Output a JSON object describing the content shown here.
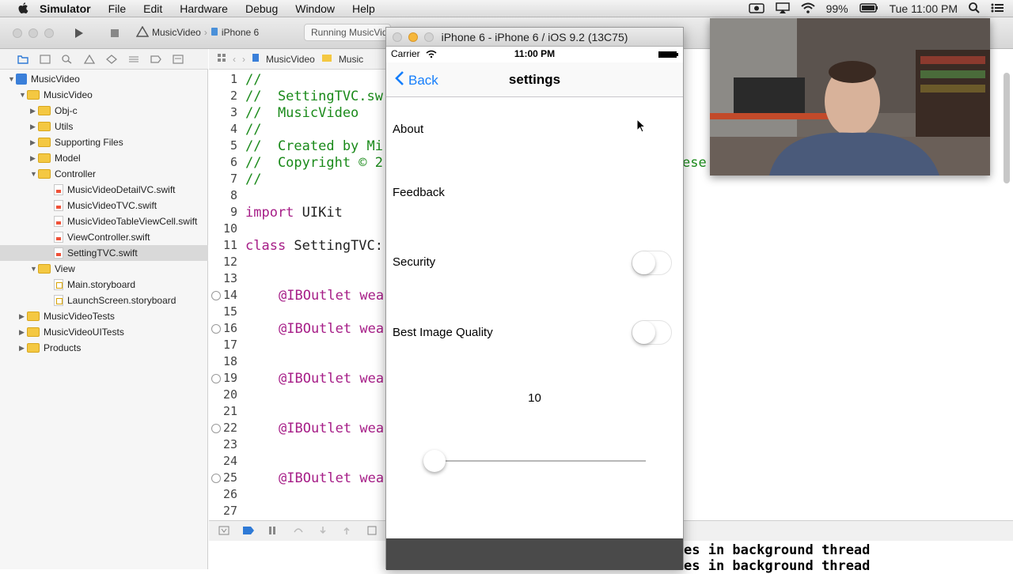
{
  "menubar": {
    "app": "Simulator",
    "items": [
      "File",
      "Edit",
      "Hardware",
      "Debug",
      "Window",
      "Help"
    ],
    "battery": "99%",
    "clock": "Tue 11:00 PM"
  },
  "toolbar": {
    "scheme": "MusicVideo",
    "device": "iPhone 6",
    "activity": "Running MusicVideo"
  },
  "jumpbar": {
    "crumb1": "MusicVideo",
    "crumb2": "Music"
  },
  "navigator": {
    "items": [
      {
        "label": "MusicVideo",
        "type": "project"
      },
      {
        "label": "MusicVideo",
        "type": "folder"
      },
      {
        "label": "Obj-c",
        "type": "folder"
      },
      {
        "label": "Utils",
        "type": "folder"
      },
      {
        "label": "Supporting Files",
        "type": "folder"
      },
      {
        "label": "Model",
        "type": "folder"
      },
      {
        "label": "Controller",
        "type": "folder"
      },
      {
        "label": "MusicVideoDetailVC.swift",
        "type": "swift"
      },
      {
        "label": "MusicVideoTVC.swift",
        "type": "swift"
      },
      {
        "label": "MusicVideoTableViewCell.swift",
        "type": "swift"
      },
      {
        "label": "ViewController.swift",
        "type": "swift"
      },
      {
        "label": "SettingTVC.swift",
        "type": "swift",
        "selected": true
      },
      {
        "label": "View",
        "type": "folder"
      },
      {
        "label": "Main.storyboard",
        "type": "storyboard"
      },
      {
        "label": "LaunchScreen.storyboard",
        "type": "storyboard"
      },
      {
        "label": "MusicVideoTests",
        "type": "folder"
      },
      {
        "label": "MusicVideoUITests",
        "type": "folder"
      },
      {
        "label": "Products",
        "type": "folder"
      }
    ]
  },
  "editor": {
    "line_numbers": [
      "1",
      "2",
      "3",
      "4",
      "5",
      "6",
      "7",
      "8",
      "9",
      "10",
      "11",
      "12",
      "13",
      "14",
      "15",
      "16",
      "17",
      "18",
      "19",
      "20",
      "21",
      "22",
      "23",
      "24",
      "25",
      "26",
      "27"
    ],
    "lines": {
      "l1": "//",
      "l2": "//  SettingTVC.sw",
      "l3": "//  MusicVideo",
      "l4": "//",
      "l5": "//  Created by Mi",
      "l6": "//  Copyright © 2",
      "l7": "//",
      "l9_kw": "import",
      "l9_rest": " UIKit",
      "l11_kw": "class",
      "l11_rest": " SettingTVC:",
      "outlet": "@IBOutlet wea",
      "l6_tail": "ese"
    }
  },
  "console": {
    "line1": "es in background thread",
    "line2": "es in background thread"
  },
  "simulator": {
    "window_title": "iPhone 6 - iPhone 6 / iOS 9.2 (13C75)",
    "carrier": "Carrier",
    "time": "11:00 PM",
    "back_label": "Back",
    "nav_title": "settings",
    "cells": {
      "about": "About",
      "feedback": "Feedback",
      "security": "Security",
      "best_image_quality": "Best Image Quality"
    },
    "switches": {
      "security_on": false,
      "best_image_quality_on": false
    },
    "slider_label": "10",
    "slider_value_fraction": 0.0
  },
  "colors": {
    "ios_tint": "#157efb",
    "comment": "#1a8a1a",
    "keyword": "#a61d87"
  }
}
